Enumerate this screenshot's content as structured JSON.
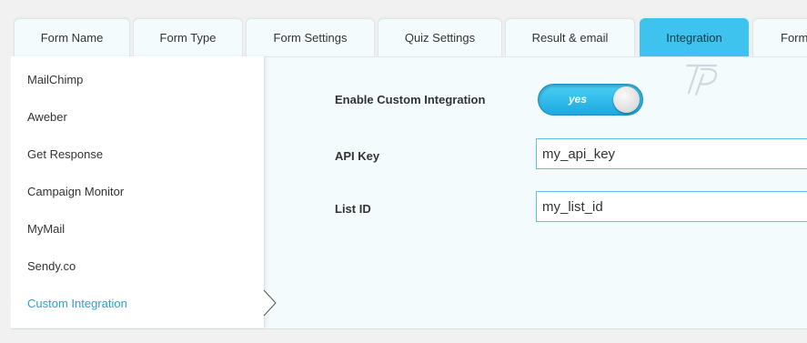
{
  "tabs": [
    {
      "label": "Form Name",
      "active": false
    },
    {
      "label": "Form Type",
      "active": false
    },
    {
      "label": "Form Settings",
      "active": false
    },
    {
      "label": "Quiz Settings",
      "active": false
    },
    {
      "label": "Result & email",
      "active": false
    },
    {
      "label": "Integration",
      "active": true
    },
    {
      "label": "Form",
      "active": false
    }
  ],
  "sidebar": {
    "items": [
      {
        "label": "MailChimp"
      },
      {
        "label": "Aweber"
      },
      {
        "label": "Get Response"
      },
      {
        "label": "Campaign Monitor"
      },
      {
        "label": "MyMail"
      },
      {
        "label": "Sendy.co"
      },
      {
        "label": "Custom Integration",
        "active": true
      }
    ]
  },
  "form": {
    "enable_label": "Enable Custom Integration",
    "enable_toggle": {
      "text": "yes",
      "on": true
    },
    "api_key_label": "API Key",
    "api_key_value": "my_api_key",
    "list_id_label": "List ID",
    "list_id_value": "my_list_id"
  },
  "colors": {
    "accent": "#3dc3ee",
    "active_link": "#2aa3d0",
    "panel_bg": "#f4fbfd"
  }
}
